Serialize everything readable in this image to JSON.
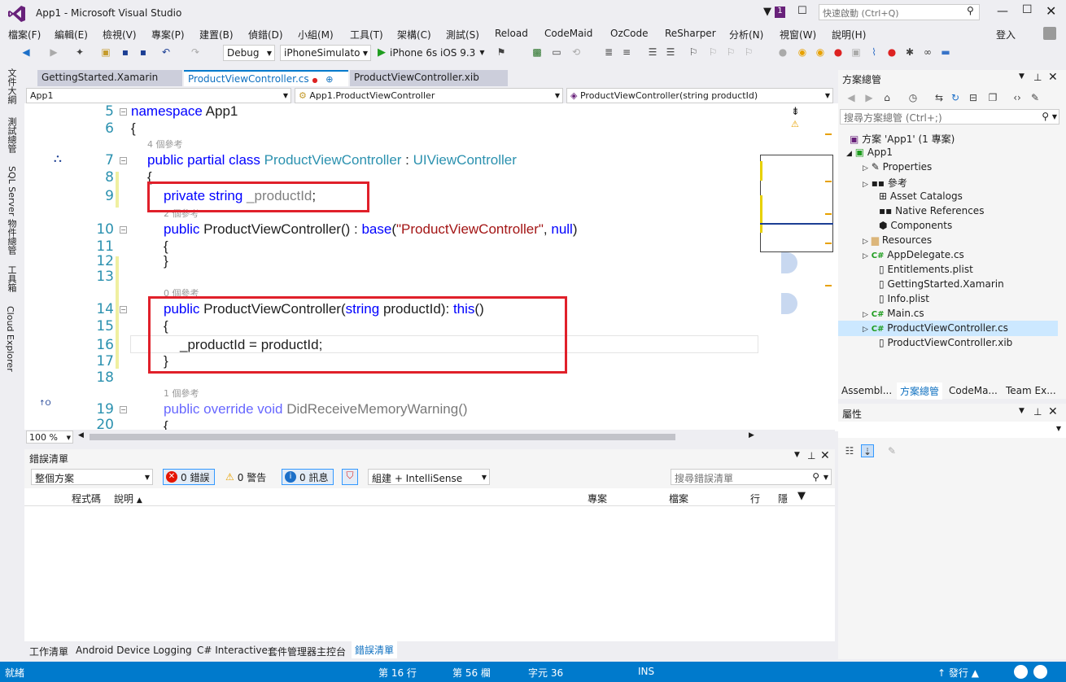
{
  "window": {
    "title": "App1 - Microsoft Visual Studio",
    "quick_launch_placeholder": "快速啟動 (Ctrl+Q)",
    "notif_count": "1",
    "signin": "登入"
  },
  "menu": [
    "檔案(F)",
    "編輯(E)",
    "檢視(V)",
    "專案(P)",
    "建置(B)",
    "偵錯(D)",
    "小組(M)",
    "工具(T)",
    "架構(C)",
    "測試(S)",
    "Reload",
    "CodeMaid",
    "OzCode",
    "ReSharper",
    "分析(N)",
    "視窗(W)",
    "說明(H)"
  ],
  "toolbar": {
    "config": "Debug",
    "platform": "iPhoneSimulato",
    "run_target": "iPhone 6s iOS 9.3"
  },
  "left_tabs": [
    "文件大綱",
    "測試總管",
    "SQL Server 物件總管",
    "工具箱",
    "Cloud Explorer"
  ],
  "doc_tabs": [
    {
      "label": "GettingStarted.Xamarin"
    },
    {
      "label": "ProductViewController.cs",
      "pin": "⊕",
      "close": "×"
    },
    {
      "label": "ProductViewController.xib"
    }
  ],
  "navbar": {
    "project": "App1",
    "type": "App1.ProductViewController",
    "member": "ProductViewController(string productId)"
  },
  "code": {
    "line_numbers": [
      "5",
      "6",
      "7",
      "8",
      "9",
      "10",
      "11",
      "12",
      "13",
      "14",
      "15",
      "16",
      "17",
      "18",
      "19",
      "20"
    ],
    "l5_kw": "namespace",
    "l5_name": " App1",
    "l6": "{",
    "ref1": "4 個參考",
    "l7_kw": "public partial class ",
    "l7_name": "ProductViewController",
    "l7_colon": " : ",
    "l7_base": "UIViewController",
    "l8": "{",
    "l9_kw": "private string ",
    "l9_field": "_productId",
    "l9_end": ";",
    "ref2": "2 個參考",
    "l10_kw": "public",
    "l10_name": " ProductViewController() : ",
    "l10_base": "base",
    "l10_p": "(",
    "l10_str": "\"ProductViewController\"",
    "l10_comma": ", ",
    "l10_null": "null",
    "l10_end": ")",
    "l11": "{",
    "l12": "}",
    "ref3": "0 個參考",
    "l14_kw": "public",
    "l14_name": " ProductViewController(",
    "l14_type": "string",
    "l14_param": " productId): ",
    "l14_this": "this",
    "l14_end": "()",
    "l15": "{",
    "l16": "_productId = productId;",
    "l17": "}",
    "ref4": "1 個參考",
    "l19_kw": "public override void ",
    "l19_name": "DidReceiveMemoryWarning()",
    "l20": "{"
  },
  "editor_status": {
    "zoom": "100 %"
  },
  "error_list": {
    "title": "錯誤清單",
    "scope": "整個方案",
    "errors": "0 錯誤",
    "warnings": "0 警告",
    "messages": "0 訊息",
    "build_filter": "組建 + IntelliSense",
    "search_placeholder": "搜尋錯誤清單",
    "columns": [
      "程式碼",
      "說明",
      "專案",
      "檔案",
      "行",
      "隱"
    ]
  },
  "bottom_tabs": [
    "工作清單",
    "Android Device Logging",
    "C# Interactive",
    "套件管理器主控台",
    "錯誤清單"
  ],
  "solution": {
    "title": "方案總管",
    "search_placeholder": "搜尋方案總管 (Ctrl+;)",
    "items": [
      {
        "label": "方案 'App1' (1 專案)"
      },
      {
        "label": "App1"
      },
      {
        "label": "Properties"
      },
      {
        "label": "參考"
      },
      {
        "label": "Asset Catalogs"
      },
      {
        "label": "Native References"
      },
      {
        "label": "Components"
      },
      {
        "label": "Resources"
      },
      {
        "label": "AppDelegate.cs"
      },
      {
        "label": "Entitlements.plist"
      },
      {
        "label": "GettingStarted.Xamarin"
      },
      {
        "label": "Info.plist"
      },
      {
        "label": "Main.cs"
      },
      {
        "label": "ProductViewController.cs"
      },
      {
        "label": "ProductViewController.xib"
      }
    ],
    "tabs": [
      "Assembl...",
      "方案總管",
      "CodeMa...",
      "Team Ex..."
    ]
  },
  "properties": {
    "title": "屬性"
  },
  "statusbar": {
    "ready": "就緒",
    "line": "第 16 行",
    "col": "第 56 欄",
    "ch": "字元 36",
    "ins": "INS",
    "publish": "發行"
  },
  "colors": {
    "accent": "#007acc",
    "highlight": "#e0202a",
    "keyword": "#0000ff",
    "type": "#2b91af",
    "string": "#a31515"
  }
}
